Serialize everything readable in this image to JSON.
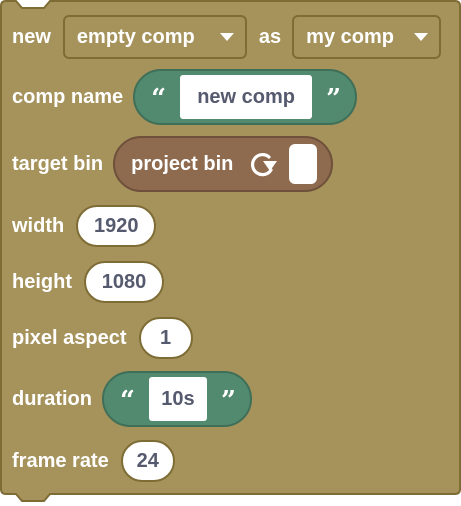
{
  "colors": {
    "block": "#a6935c",
    "block_border": "#7e6c35",
    "string_block": "#528a70",
    "bin_block": "#8e6a4f",
    "label_text": "#ffffff",
    "field_text": "#565a6e"
  },
  "header": {
    "new_label": "new",
    "type_dropdown": "empty comp",
    "as_label": "as",
    "var_dropdown": "my comp"
  },
  "fields": {
    "comp_name": {
      "label": "comp name",
      "value": "new comp",
      "open_quote": "“",
      "close_quote": "”"
    },
    "target_bin": {
      "label": "target bin",
      "value": "project bin",
      "icon": "refresh-icon"
    },
    "width": {
      "label": "width",
      "value": "1920"
    },
    "height": {
      "label": "height",
      "value": "1080"
    },
    "pixel_aspect": {
      "label": "pixel aspect",
      "value": "1"
    },
    "duration": {
      "label": "duration",
      "value": "10s",
      "open_quote": "“",
      "close_quote": "”"
    },
    "frame_rate": {
      "label": "frame rate",
      "value": "24"
    }
  }
}
